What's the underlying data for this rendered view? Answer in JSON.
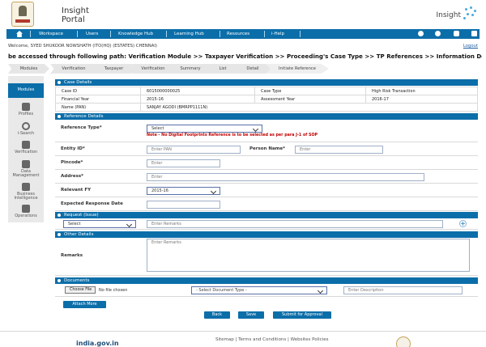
{
  "header": {
    "title": "Insight",
    "subtitle": "Portal",
    "right_title": "Insight"
  },
  "nav": {
    "items": [
      "Workspace",
      "Users",
      "Knowledge Hub",
      "Learning Hub",
      "Resources",
      "i-Help"
    ]
  },
  "user": {
    "welcome": "Welcome, SYED SHUKOOR NOWSHATH (ITO(HQ) (ESTATES) CHENNAI)",
    "logout": "Logout"
  },
  "path": {
    "text": "be accessed through following path: Verification Module >> Taxpayer Verification >> Proceeding's Case Type >> TP References >> Information Details (I"
  },
  "breadcrumbs": [
    "Modules",
    "Verification",
    "Taxpayer",
    "Verification",
    "Summary",
    "List",
    "Detail",
    "Initiate Reference"
  ],
  "sidebar": {
    "header": "Modules",
    "items": [
      {
        "label": "Profiles",
        "icon": "profile-icon"
      },
      {
        "label": "i-Search",
        "icon": "search-icon"
      },
      {
        "label": "Verification",
        "icon": "verification-icon"
      },
      {
        "label": "Data Management",
        "icon": "data-management-icon"
      },
      {
        "label": "Business Intelligence",
        "icon": "business-intelligence-icon"
      },
      {
        "label": "Operations",
        "icon": "operations-icon"
      }
    ]
  },
  "sections": {
    "case": "Case Details",
    "reference": "Reference Details",
    "request": "Request (Issue)",
    "other": "Other Details",
    "documents": "Documents"
  },
  "case_details": {
    "rows": [
      {
        "label": "Case ID",
        "value": "6015000000025",
        "label2": "Case Type",
        "value2": "High Risk Transaction"
      },
      {
        "label": "Financial Year",
        "value": "2015-16",
        "label2": "Assessment Year",
        "value2": "2016-17"
      },
      {
        "label": "Name (PAN)",
        "value": "SANJAY AGODI (BMRPP1111N)"
      }
    ]
  },
  "reference": {
    "type_label": "Reference Type*",
    "type_value": "Select",
    "note": "Note - No Digital Footprints Reference  is to be selected as per para J-1 of SOP",
    "entity_label": "Entity ID*",
    "entity_placeholder": "Enter PAN",
    "person_label": "Person Name*",
    "person_placeholder": "Enter",
    "pincode_label": "Pincode*",
    "pincode_placeholder": "Enter",
    "address_label": "Address*",
    "address_placeholder": "Enter",
    "fy_label": "Relevant FY",
    "fy_value": "2015-16",
    "response_label": "Expected Response Date"
  },
  "request": {
    "select": "Select",
    "remarks_placeholder": "Enter Remarks",
    "plus": "+"
  },
  "other": {
    "remarks_label": "Remarks",
    "remarks_placeholder": "Enter Remarks"
  },
  "documents": {
    "choose": "Choose File",
    "no_file": "No file chosen",
    "type_value": "- Select Document Type -",
    "description_placeholder": "Enter Description",
    "attach": "Attach More"
  },
  "actions": {
    "back": "Back",
    "save": "Save",
    "submit": "Submit for Approval"
  },
  "footer": {
    "links": "Sitemap | Terms and Conditions | Websites Policies",
    "badge": "india.gov.in"
  }
}
